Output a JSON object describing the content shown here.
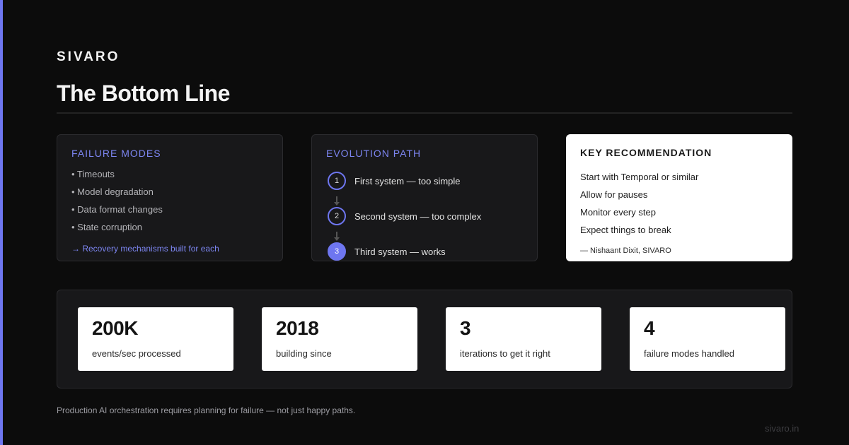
{
  "brand": "SIVARO",
  "title": "The Bottom Line",
  "failure_modes": {
    "heading": "FAILURE MODES",
    "items": [
      "• Timeouts",
      "• Model degradation",
      "• Data format changes",
      "• State corruption"
    ],
    "link": "→ Recovery mechanisms built for each"
  },
  "evolution": {
    "heading": "EVOLUTION PATH",
    "steps": [
      {
        "number": "1",
        "label": "First system — too simple"
      },
      {
        "number": "2",
        "label": "Second system — too complex"
      },
      {
        "number": "3",
        "label": "Third system — works"
      }
    ]
  },
  "recommendation": {
    "heading": "KEY RECOMMENDATION",
    "items": [
      "Start with Temporal or similar",
      "Allow for pauses",
      "Monitor every step",
      "Expect things to break"
    ],
    "attribution": "— Nishaant Dixit, SIVARO"
  },
  "stats": [
    {
      "value": "200K",
      "label": "events/sec processed"
    },
    {
      "value": "2018",
      "label": "building since"
    },
    {
      "value": "3",
      "label": "iterations to get it right"
    },
    {
      "value": "4",
      "label": "failure modes handled"
    }
  ],
  "footer_note": "Production AI orchestration requires planning for failure — not just happy paths.",
  "site": "sivaro.in",
  "colors": {
    "background": "#0c0c0c",
    "accent": "#6e76f0",
    "card_dark": "#18181a",
    "card_light": "#ffffff"
  }
}
